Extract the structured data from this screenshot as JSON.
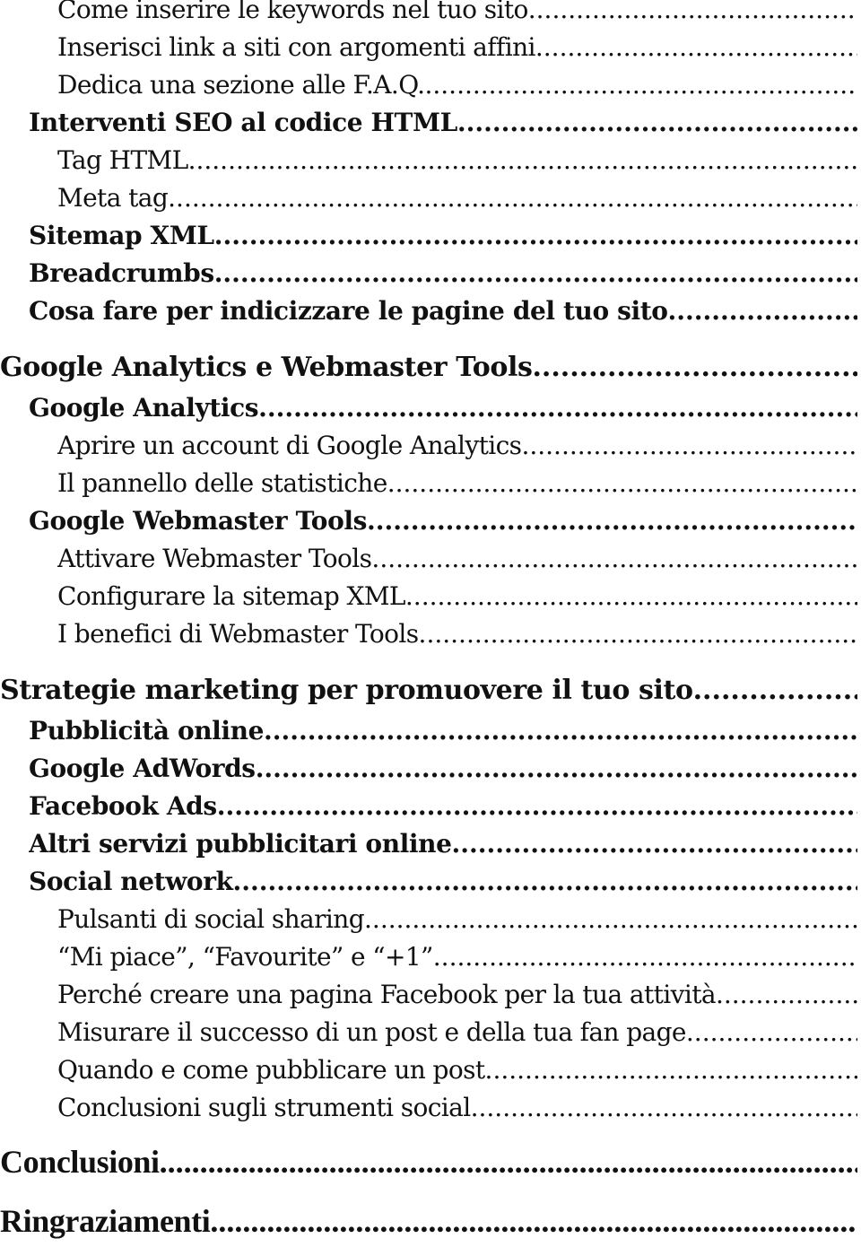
{
  "toc": {
    "entries": [
      {
        "level": 3,
        "text": "Come inserire le keywords nel tuo sito"
      },
      {
        "level": 3,
        "text": "Inserisci link a siti con argomenti affini"
      },
      {
        "level": 3,
        "text": "Dedica una sezione alle F.A.Q."
      },
      {
        "level": 2,
        "text": "Interventi SEO al codice HTML"
      },
      {
        "level": 3,
        "text": "Tag HTML"
      },
      {
        "level": 3,
        "text": "Meta tag"
      },
      {
        "level": 2,
        "text": "Sitemap XML"
      },
      {
        "level": 2,
        "text": "Breadcrumbs"
      },
      {
        "level": 2,
        "text": "Cosa fare per indicizzare le pagine del tuo sito"
      },
      {
        "level": 1,
        "text": "Google Analytics e Webmaster Tools"
      },
      {
        "level": 2,
        "text": "Google Analytics"
      },
      {
        "level": 3,
        "text": "Aprire un account di Google Analytics"
      },
      {
        "level": 3,
        "text": "Il pannello delle statistiche"
      },
      {
        "level": 2,
        "text": "Google Webmaster Tools"
      },
      {
        "level": 3,
        "text": "Attivare Webmaster Tools"
      },
      {
        "level": 3,
        "text": "Configurare la sitemap XML"
      },
      {
        "level": 3,
        "text": "I benefici di Webmaster Tools"
      },
      {
        "level": 1,
        "text": "Strategie marketing per promuovere il tuo sito"
      },
      {
        "level": 2,
        "text": "Pubblicità online"
      },
      {
        "level": 2,
        "text": "Google AdWords"
      },
      {
        "level": 2,
        "text": "Facebook Ads"
      },
      {
        "level": 2,
        "text": "Altri servizi pubblicitari online"
      },
      {
        "level": 2,
        "text": "Social network"
      },
      {
        "level": 3,
        "text": "Pulsanti di social sharing"
      },
      {
        "level": 3,
        "text": "“Mi piace”, “Favourite” e “+1”"
      },
      {
        "level": 3,
        "text": "Perché creare una pagina Facebook per la tua attività"
      },
      {
        "level": 3,
        "text": "Misurare il successo di un post e della tua fan page"
      },
      {
        "level": 3,
        "text": "Quando e come pubblicare un post"
      },
      {
        "level": 3,
        "text": "Conclusioni sugli strumenti social"
      },
      {
        "level": 1,
        "text": "Conclusioni"
      },
      {
        "level": 1,
        "text": "Ringraziamenti"
      }
    ]
  }
}
